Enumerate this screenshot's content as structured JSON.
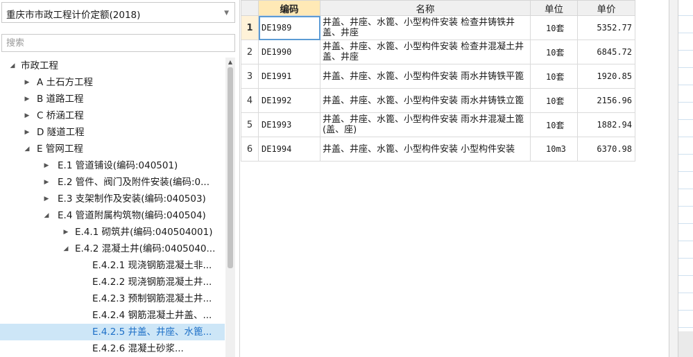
{
  "quota_select": {
    "value": "重庆市市政工程计价定额(2018)",
    "arrow_icon": "chevron-down-icon"
  },
  "search": {
    "placeholder": "搜索",
    "value": ""
  },
  "tree": [
    {
      "label": "市政工程",
      "level": 0,
      "expanded": true
    },
    {
      "label": "A 土石方工程",
      "level": 1,
      "expanded": false
    },
    {
      "label": "B 道路工程",
      "level": 1,
      "expanded": false
    },
    {
      "label": "C 桥涵工程",
      "level": 1,
      "expanded": false
    },
    {
      "label": "D 隧道工程",
      "level": 1,
      "expanded": false
    },
    {
      "label": "E 管网工程",
      "level": 1,
      "expanded": true
    },
    {
      "label": "E.1 管道铺设(编码:040501)",
      "level": 2,
      "expanded": false
    },
    {
      "label": "E.2 管件、阀门及附件安装(编码:0...",
      "level": 2,
      "expanded": false
    },
    {
      "label": "E.3 支架制作及安装(编码:040503)",
      "level": 2,
      "expanded": false
    },
    {
      "label": "E.4 管道附属构筑物(编码:040504)",
      "level": 2,
      "expanded": true
    },
    {
      "label": "E.4.1 砌筑井(编码:040504001)",
      "level": 3,
      "expanded": false
    },
    {
      "label": "E.4.2 混凝土井(编码:0405040...",
      "level": 3,
      "expanded": true
    },
    {
      "label": "E.4.2.1 现浇钢筋混凝土非...",
      "level": 4,
      "leaf": true
    },
    {
      "label": "E.4.2.2 现浇钢筋混凝土井...",
      "level": 4,
      "leaf": true
    },
    {
      "label": "E.4.2.3 预制钢筋混凝土井...",
      "level": 4,
      "leaf": true
    },
    {
      "label": "E.4.2.4 钢筋混凝土井盖、...",
      "level": 4,
      "leaf": true
    },
    {
      "label": "E.4.2.5 井盖、井座、水篦...",
      "level": 4,
      "leaf": true,
      "selected": true
    },
    {
      "label": "E.4.2.6 混凝土砂浆...",
      "level": 4,
      "leaf": true
    }
  ],
  "table": {
    "headers": {
      "code": "编码",
      "name": "名称",
      "unit": "单位",
      "price": "单价"
    },
    "rows": [
      {
        "no": "1",
        "code": "DE1989",
        "name": "井盖、井座、水篦、小型构件安装 检查井铸铁井盖、井座",
        "unit": "10套",
        "price": "5352.77"
      },
      {
        "no": "2",
        "code": "DE1990",
        "name": "井盖、井座、水篦、小型构件安装 检查井混凝土井盖、井座",
        "unit": "10套",
        "price": "6845.72"
      },
      {
        "no": "3",
        "code": "DE1991",
        "name": "井盖、井座、水篦、小型构件安装 雨水井铸铁平篦",
        "unit": "10套",
        "price": "1920.85"
      },
      {
        "no": "4",
        "code": "DE1992",
        "name": "井盖、井座、水篦、小型构件安装 雨水井铸铁立篦",
        "unit": "10套",
        "price": "2156.96"
      },
      {
        "no": "5",
        "code": "DE1993",
        "name": "井盖、井座、水篦、小型构件安装 雨水井混凝土篦(盖、座)",
        "unit": "10套",
        "price": "1882.94"
      },
      {
        "no": "6",
        "code": "DE1994",
        "name": "井盖、井座、水篦、小型构件安装 小型构件安装",
        "unit": "10m3",
        "price": "6370.98"
      }
    ]
  },
  "colors": {
    "selected_bg": "#cde6f7",
    "selected_text": "#1c6fc7",
    "header_code_bg": "#ffe9b6",
    "active_row_bg": "#fff2d8"
  }
}
